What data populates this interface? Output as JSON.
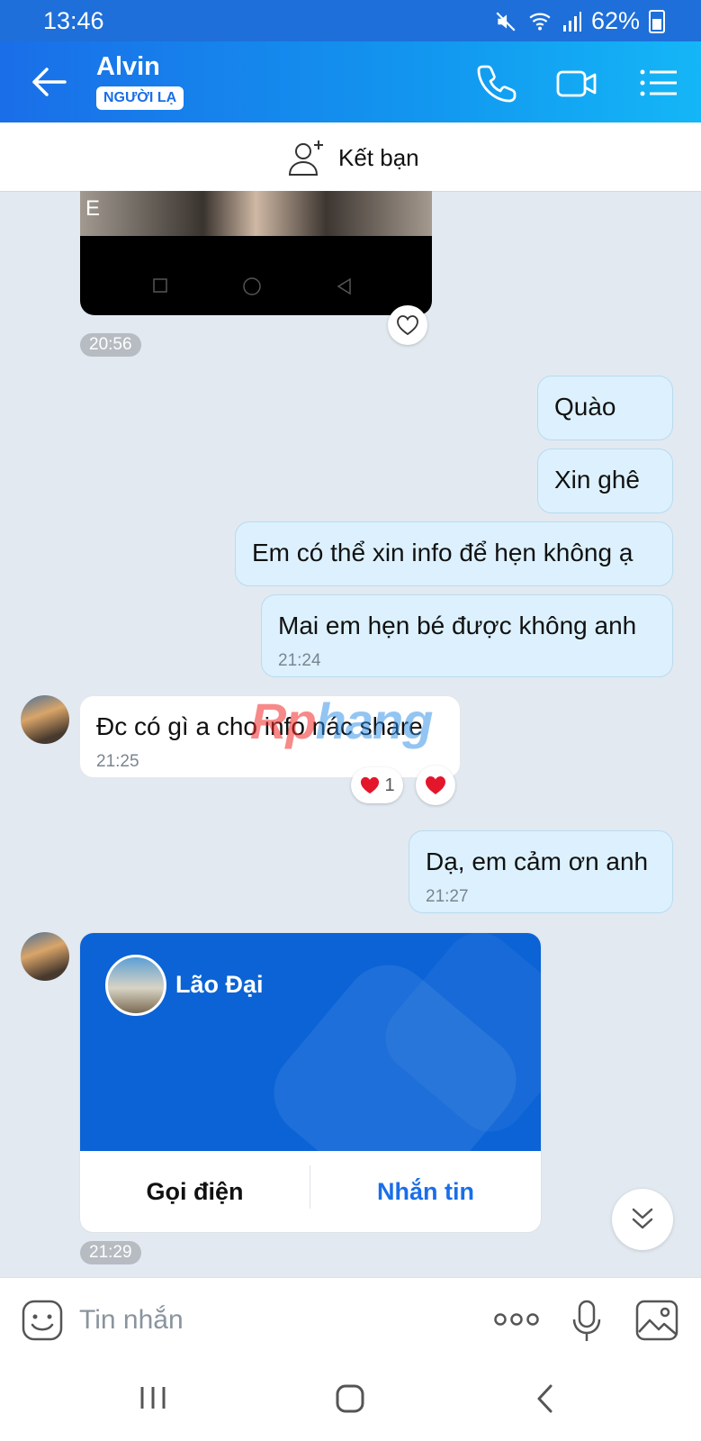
{
  "status_bar": {
    "time": "13:46",
    "battery": "62%"
  },
  "header": {
    "contact_name": "Alvin",
    "badge": "NGƯỜI LẠ",
    "icons": [
      "back-arrow-icon",
      "phone-icon",
      "video-call-icon",
      "menu-list-icon"
    ]
  },
  "add_friend": {
    "label": "Kết bạn"
  },
  "messages": [
    {
      "side": "them",
      "type": "image",
      "time": "20:56"
    },
    {
      "side": "me",
      "text": "Quào"
    },
    {
      "side": "me",
      "text": "Xin ghê"
    },
    {
      "side": "me",
      "text": "Em có thể xin info để hẹn không ạ"
    },
    {
      "side": "me",
      "text": "Mai em hẹn bé được không anh",
      "time": "21:24"
    },
    {
      "side": "them",
      "text": "Đc có gì a cho info nác share",
      "time": "21:25",
      "reaction_count": "1"
    },
    {
      "side": "me",
      "text": "Dạ, em cảm ơn anh",
      "time": "21:27"
    }
  ],
  "contact_card": {
    "name": "Lão Đại",
    "call_label": "Gọi điện",
    "message_label": "Nhắn tin",
    "time": "21:29"
  },
  "watermark": {
    "part1": "Rp",
    "part2": "hang"
  },
  "composer": {
    "placeholder": "Tin nhắn"
  },
  "colors": {
    "header_start": "#1a6ee8",
    "header_end": "#14b6f7",
    "chat_background": "#e2e9f1",
    "my_bubble": "#dcf1fd",
    "card_blue": "#0b63d6",
    "link_blue": "#1a6ee8"
  }
}
